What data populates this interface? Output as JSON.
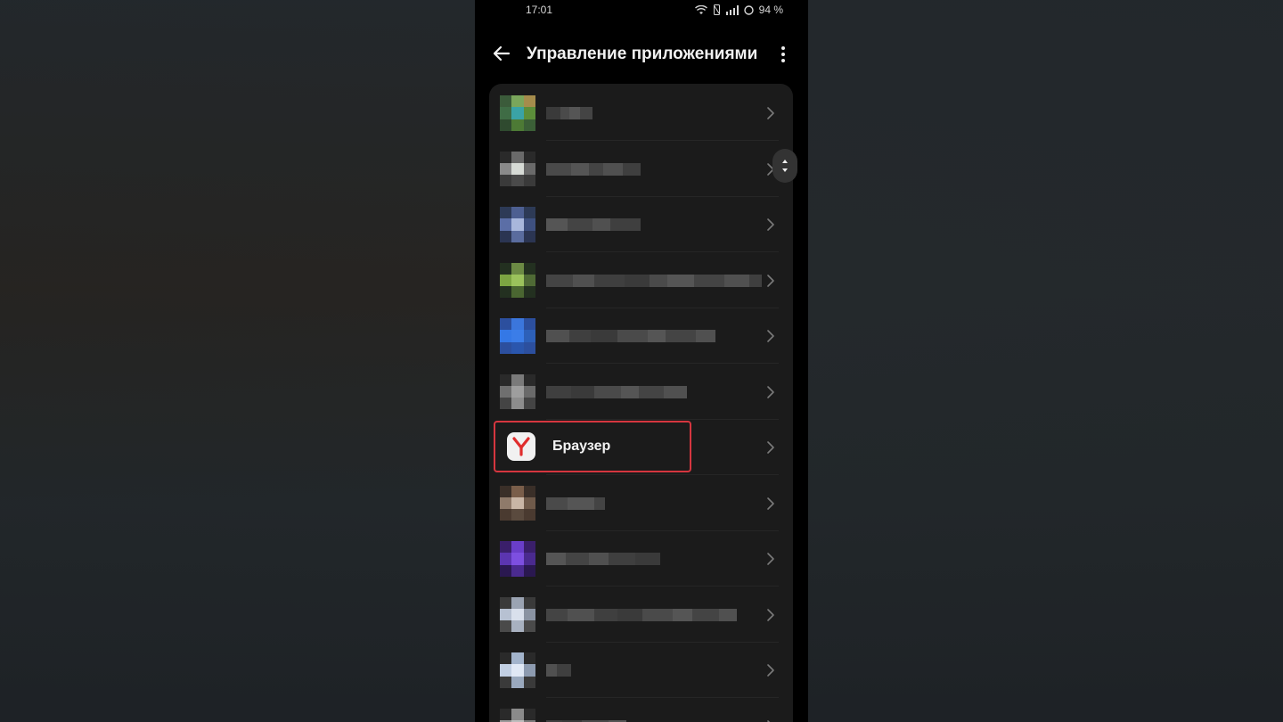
{
  "status_bar": {
    "time": "17:01",
    "battery": "94 %"
  },
  "appbar": {
    "title": "Управление приложениями",
    "back_icon": "back-arrow-icon",
    "menu_icon": "more-vert-icon"
  },
  "apps": [
    {
      "label": "",
      "redacted": true,
      "icon_colors": [
        "#3b5b3a",
        "#7aa65b",
        "#a58c4c",
        "#3f6c45",
        "#3aa3a6",
        "#5c8e3a",
        "#2f4a2f",
        "#4d7a35",
        "#3b5f37"
      ]
    },
    {
      "label": "",
      "redacted": true,
      "icon_colors": [
        "#2a2a2a",
        "#6a6a6a",
        "#2a2a2a",
        "#8a8a8a",
        "#d7dbd6",
        "#6a6a6a",
        "#3a3a3a",
        "#4a4a4a",
        "#3a3a3a"
      ]
    },
    {
      "label": "",
      "redacted": true,
      "icon_colors": [
        "#2d3a56",
        "#4d5f91",
        "#2d3a56",
        "#5b6ea6",
        "#a8b7dc",
        "#3e507f",
        "#2b3552",
        "#5a6c9e",
        "#2b3552"
      ]
    },
    {
      "label": "",
      "redacted": true,
      "icon_colors": [
        "#233020",
        "#6c8a44",
        "#233020",
        "#7ca542",
        "#9bc25c",
        "#4f6a35",
        "#233020",
        "#4a6631",
        "#233020"
      ]
    },
    {
      "label": "",
      "redacted": true,
      "icon_colors": [
        "#2c4f9e",
        "#3b76dc",
        "#2c4f9e",
        "#3478e6",
        "#3b7de8",
        "#2d60b8",
        "#2c4f9e",
        "#2a56ad",
        "#2c4f9e"
      ]
    },
    {
      "label": "",
      "redacted": true,
      "icon_colors": [
        "#2a2a2a",
        "#7a7a7a",
        "#2a2a2a",
        "#6f6f6f",
        "#9e9e9e",
        "#6a6a6a",
        "#444444",
        "#8d8d8d",
        "#444444"
      ]
    },
    {
      "label": "Браузер",
      "redacted": false,
      "icon": "yandex-browser-icon"
    },
    {
      "label": "",
      "redacted": true,
      "icon_colors": [
        "#3a2f28",
        "#7a5e4a",
        "#3a2f28",
        "#8f7a6a",
        "#c9b6a6",
        "#6f5a4a",
        "#4a3a30",
        "#5a4a3e",
        "#4a3a30"
      ]
    },
    {
      "label": "",
      "redacted": true,
      "icon_colors": [
        "#3a1f6a",
        "#6a3ec9",
        "#3a1f6a",
        "#5b35b0",
        "#7d4fe0",
        "#4a2a8f",
        "#2a1850",
        "#4a2a8f",
        "#2a1850"
      ]
    },
    {
      "label": "",
      "redacted": true,
      "icon_colors": [
        "#3a3a3a",
        "#9aa3b2",
        "#3a3a3a",
        "#b7c1d2",
        "#d9e0ec",
        "#8a93a2",
        "#4a4a4a",
        "#a8b1c0",
        "#4a4a4a"
      ]
    },
    {
      "label": "",
      "redacted": true,
      "icon_colors": [
        "#2a2a2a",
        "#a3b4cc",
        "#2a2a2a",
        "#c2cfe3",
        "#e0e8f5",
        "#8d9bb0",
        "#3a3a3a",
        "#9aa9be",
        "#3a3a3a"
      ]
    },
    {
      "label": "",
      "redacted": true,
      "icon_colors": [
        "#2a2a2a",
        "#8a8a8a",
        "#2a2a2a",
        "#9a9a9a",
        "#bdbdbd",
        "#7a7a7a",
        "#2a2a2a",
        "#6a6a6a",
        "#2a2a2a"
      ]
    }
  ],
  "highlight_color": "#d6363f"
}
